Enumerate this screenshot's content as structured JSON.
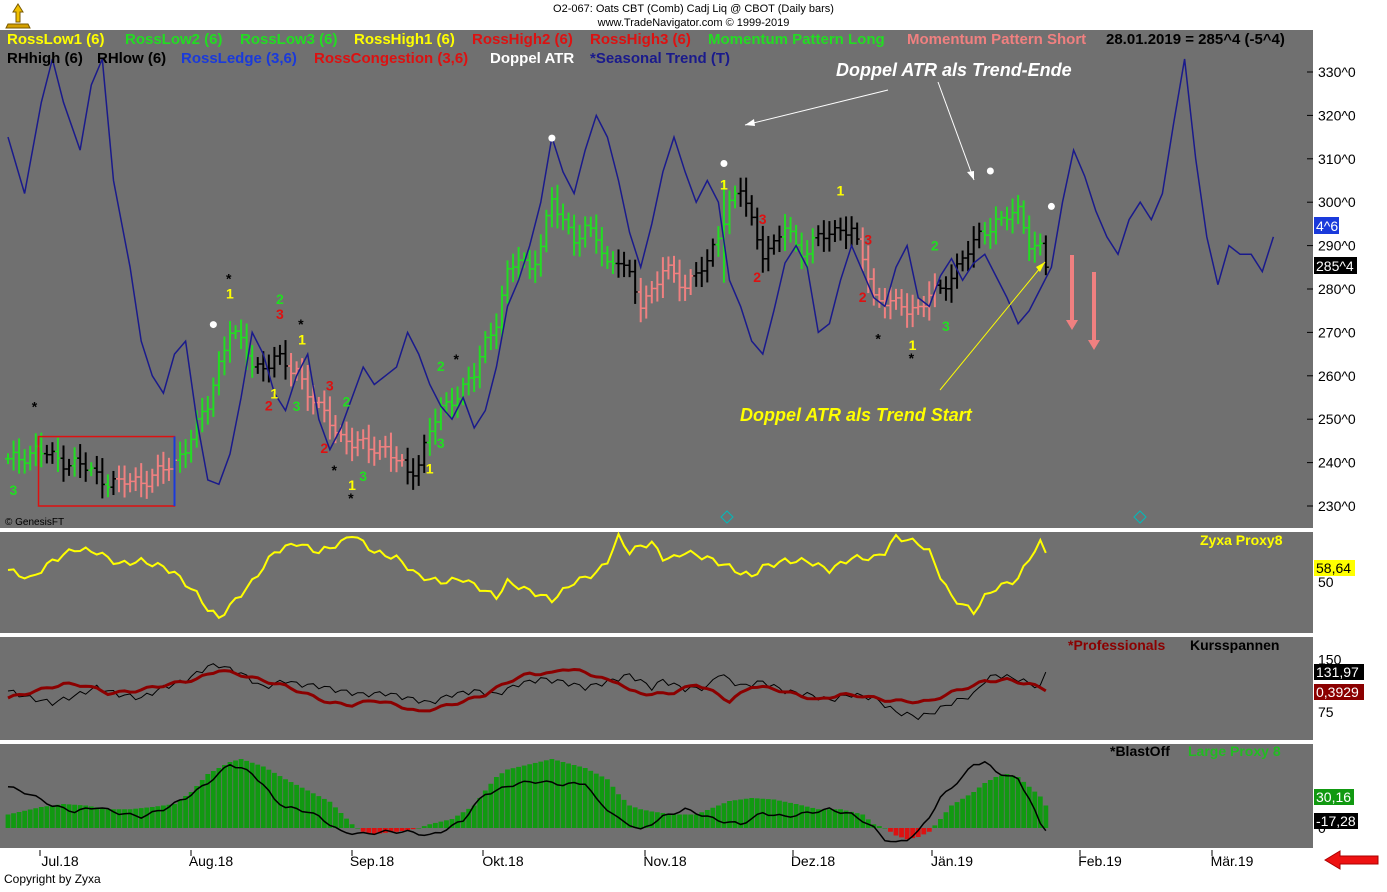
{
  "header": {
    "line1": "O2-067:  Oats CBT (Comb) Cadj Liq @ CBOT  (Daily bars)",
    "line2": "www.TradeNavigator.com © 1999-2019"
  },
  "legend_row1": [
    {
      "label": "RossLow1 (6)",
      "color": "#ffff00"
    },
    {
      "label": "RossLow2 (6)",
      "color": "#22dd22"
    },
    {
      "label": "RossLow3 (6)",
      "color": "#22dd22"
    },
    {
      "label": "RossHigh1 (6)",
      "color": "#ffff00"
    },
    {
      "label": "RossHigh2 (6)",
      "color": "#dd1111"
    },
    {
      "label": "RossHigh3 (6)",
      "color": "#dd1111"
    },
    {
      "label": "Momentum Pattern Long",
      "color": "#22dd22"
    },
    {
      "label": "Momentum Pattern Short",
      "color": "#f08080"
    },
    {
      "label": "28.01.2019 = 285^4 (-5^4)",
      "color": "#000000"
    }
  ],
  "legend_row2": [
    {
      "label": "RHhigh (6)",
      "color": "#000000"
    },
    {
      "label": "RHlow (6)",
      "color": "#000000"
    },
    {
      "label": "RossLedge (3,6)",
      "color": "#1a3adb"
    },
    {
      "label": "RossCongestion (3,6)",
      "color": "#dd1111"
    },
    {
      "label": "Doppel ATR",
      "color": "#ffffff"
    },
    {
      "label": "*Seasonal Trend (T)",
      "color": "#1a1a8c"
    }
  ],
  "annotations": {
    "trend_end": "Doppel ATR als Trend-Ende",
    "trend_start": "Doppel ATR als Trend Start",
    "genesis": "© GenesisFT",
    "copyright": "Copyright by Zyxa"
  },
  "colors": {
    "panel_bg": "#707070",
    "axis_bg": "#ffffff",
    "long": "#22dd22",
    "short": "#f08080",
    "neutral": "#000000",
    "seasonal": "#1a1a8c",
    "zyxa": "#ffff00",
    "professionals": "#8b0000",
    "kursspannen": "#000000",
    "blastoff_pos": "#119911",
    "blastoff_neg": "#dd1111",
    "marker_yellow": "#ffff00",
    "marker_green": "#22dd22",
    "marker_red": "#dd1111"
  },
  "chart_data": [
    {
      "type": "candlestick",
      "title": "Oats CBT (Comb) Cadj Liq @ CBOT",
      "x_tick_labels": [
        "Jul.18",
        "Aug.18",
        "Sep.18",
        "Okt.18",
        "Nov.18",
        "Dez.18",
        "Jän.19",
        "Feb.19",
        "Mär.19"
      ],
      "y_tick_labels": [
        "230^0",
        "240^0",
        "250^0",
        "260^0",
        "270^0",
        "280^0",
        "290^0",
        "300^0",
        "310^0",
        "320^0",
        "330^0"
      ],
      "ylim": [
        225,
        336
      ],
      "last_value_labels": [
        "4^6",
        "285^4"
      ],
      "signal_markers": [
        {
          "i": 1,
          "text": "3",
          "color": "green",
          "pos": "below"
        },
        {
          "i": 5,
          "text": "*",
          "color": "black",
          "pos": "above"
        },
        {
          "i": 40,
          "text": "1",
          "color": "yellow",
          "pos": "above"
        },
        {
          "i": 40,
          "text": "*",
          "color": "black",
          "pos": "above2"
        },
        {
          "i": 47,
          "text": "2",
          "color": "red",
          "pos": "below"
        },
        {
          "i": 48,
          "text": "1",
          "color": "yellow",
          "pos": "below"
        },
        {
          "i": 49,
          "text": "3",
          "color": "red",
          "pos": "above"
        },
        {
          "i": 49,
          "text": "2",
          "color": "green",
          "pos": "above2"
        },
        {
          "i": 52,
          "text": "3",
          "color": "green",
          "pos": "below"
        },
        {
          "i": 53,
          "text": "1",
          "color": "yellow",
          "pos": "above"
        },
        {
          "i": 53,
          "text": "*",
          "color": "black",
          "pos": "above2"
        },
        {
          "i": 58,
          "text": "3",
          "color": "red",
          "pos": "above"
        },
        {
          "i": 57,
          "text": "2",
          "color": "red",
          "pos": "below"
        },
        {
          "i": 61,
          "text": "2",
          "color": "green",
          "pos": "above"
        },
        {
          "i": 59,
          "text": "*",
          "color": "black",
          "pos": "below"
        },
        {
          "i": 62,
          "text": "1",
          "color": "yellow",
          "pos": "below"
        },
        {
          "i": 62,
          "text": "*",
          "color": "black",
          "pos": "below2"
        },
        {
          "i": 64,
          "text": "3",
          "color": "green",
          "pos": "below"
        },
        {
          "i": 76,
          "text": "1",
          "color": "yellow",
          "pos": "below"
        },
        {
          "i": 78,
          "text": "2",
          "color": "green",
          "pos": "above"
        },
        {
          "i": 78,
          "text": "3",
          "color": "green",
          "pos": "below"
        },
        {
          "i": 81,
          "text": "*",
          "color": "black",
          "pos": "above"
        },
        {
          "i": 129,
          "text": "1",
          "color": "yellow",
          "pos": "above"
        },
        {
          "i": 136,
          "text": "3",
          "color": "red",
          "pos": "above"
        },
        {
          "i": 135,
          "text": "2",
          "color": "red",
          "pos": "below"
        },
        {
          "i": 150,
          "text": "1",
          "color": "yellow",
          "pos": "above"
        },
        {
          "i": 155,
          "text": "3",
          "color": "red",
          "pos": "above"
        },
        {
          "i": 154,
          "text": "2",
          "color": "red",
          "pos": "below"
        },
        {
          "i": 157,
          "text": "*",
          "color": "black",
          "pos": "below"
        },
        {
          "i": 163,
          "text": "1",
          "color": "yellow",
          "pos": "below"
        },
        {
          "i": 163,
          "text": "*",
          "color": "black",
          "pos": "below2"
        },
        {
          "i": 167,
          "text": "2",
          "color": "green",
          "pos": "above"
        },
        {
          "i": 169,
          "text": "3",
          "color": "green",
          "pos": "below"
        }
      ],
      "doppel_atr_dots": [
        37,
        98,
        129,
        177,
        188
      ]
    },
    {
      "type": "line",
      "title": "Zyxa Proxy8",
      "last_value": "58,64",
      "y_tick_labels": [
        "50"
      ],
      "ylim": [
        35,
        75
      ]
    },
    {
      "type": "line",
      "series_titles": [
        "*Professionals",
        "Kursspannen"
      ],
      "last_values": [
        "131,97",
        "0,3929"
      ],
      "y_tick_labels": [
        "150",
        "75"
      ],
      "ylim": [
        45,
        160
      ]
    },
    {
      "type": "bar",
      "series_titles": [
        "*BlastOff",
        "Large Proxy 8"
      ],
      "last_values": [
        "30,16",
        "-17,28"
      ],
      "y_tick_labels": [
        "0"
      ],
      "ylim": [
        -30,
        115
      ]
    }
  ],
  "arrows_right": "left-red-arrow"
}
